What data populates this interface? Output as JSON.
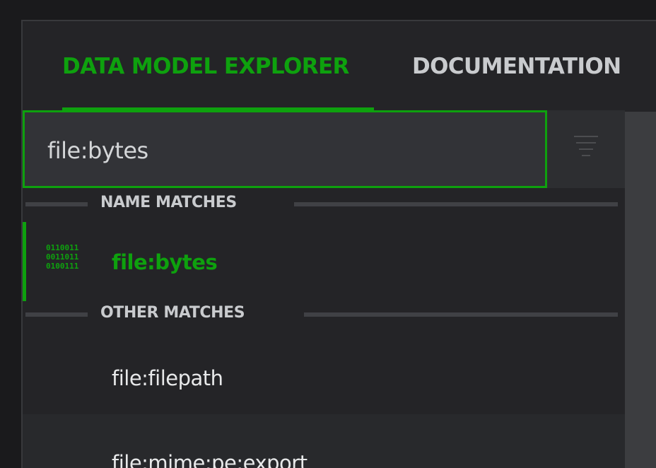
{
  "tabs": [
    {
      "label": "DATA MODEL EXPLORER",
      "active": true
    },
    {
      "label": "DOCUMENTATION",
      "active": false
    }
  ],
  "search": {
    "value": "file:bytes",
    "filter_icon": "filter-icon"
  },
  "sections": {
    "name_matches": {
      "label": "NAME MATCHES",
      "items": [
        {
          "label": "file:bytes",
          "icon": "binary-icon",
          "icon_text": [
            "0110011",
            "0011011",
            "0100111"
          ],
          "selected": true
        }
      ]
    },
    "other_matches": {
      "label": "OTHER MATCHES",
      "items": [
        {
          "label": "file:filepath"
        },
        {
          "label": "file:mime:pe:export"
        }
      ]
    }
  },
  "colors": {
    "accent": "#0ea10e",
    "background": "#242427",
    "text": "#c9cbce"
  }
}
